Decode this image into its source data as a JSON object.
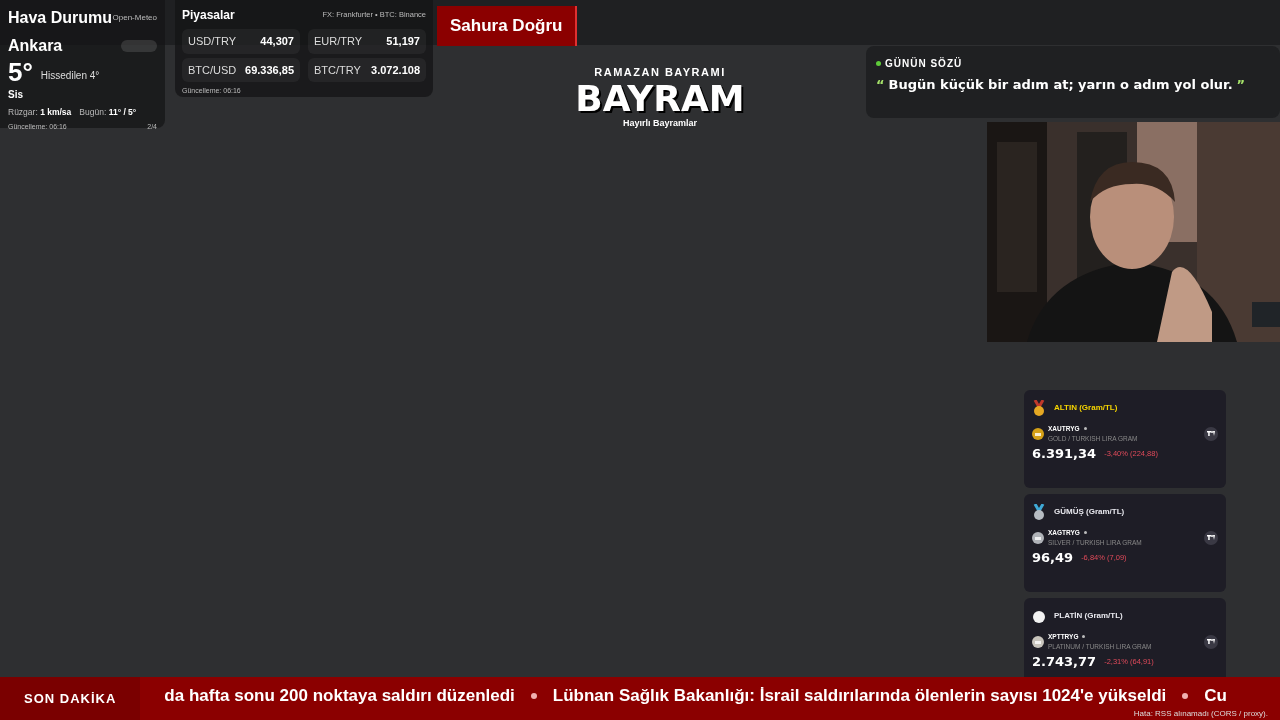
{
  "weather": {
    "title": "Hava Durumu",
    "source": "Open-Meteo",
    "city": "Ankara",
    "temperature": "5°",
    "feels_like": "Hissedilen 4°",
    "condition": "Sis",
    "wind_label": "Rüzgar:",
    "wind": "1 km/sa",
    "today_label": "Bugün:",
    "today": "11° / 5°",
    "updated": "Güncelleme: 06:16",
    "page": "2/4"
  },
  "markets": {
    "title": "Piyasalar",
    "source": "FX: Frankfurter • BTC: Binance",
    "updated": "Güncelleme: 06:16",
    "rates": [
      {
        "pair": "USD/TRY",
        "value": "44,307"
      },
      {
        "pair": "EUR/TRY",
        "value": "51,197"
      },
      {
        "pair": "BTC/USD",
        "value": "69.336,85"
      },
      {
        "pair": "BTC/TRY",
        "value": "3.072.108"
      }
    ]
  },
  "countdown": {
    "label": "Sahura Doğru"
  },
  "headline": {
    "overline": "RAMAZAN BAYRAMI",
    "title": "BAYRAM",
    "subtitle": "Hayırlı Bayramlar"
  },
  "quote": {
    "label": "GÜNÜN SÖZÜ",
    "open_mark": "“",
    "text": "Bugün küçük bir adım at; yarın o adım yol olur.",
    "close_mark": "”"
  },
  "metals": [
    {
      "title": "ALTIN (Gram/TL)",
      "kind": "gold",
      "color": "#d4a017",
      "symbol": "XAUTRYG",
      "description": "GOLD / TURKISH LIRA GRAM",
      "price": "6.391,34",
      "change": "-3,40% (224,88)"
    },
    {
      "title": "GÜMÜŞ (Gram/TL)",
      "kind": "silver",
      "color": "#b0b3b8",
      "symbol": "XAGTRYG",
      "description": "SILVER / TURKISH LIRA GRAM",
      "price": "96,49",
      "change": "-6,84% (7,09)"
    },
    {
      "title": "PLATİN (Gram/TL)",
      "kind": "plain",
      "color": "#c8c4bc",
      "symbol": "XPTTRYG",
      "description": "PLATINUM / TURKISH LIRA GRAM",
      "price": "2.743,77",
      "change": "-2,31% (64,91)"
    }
  ],
  "ticker": {
    "label": "SON DAKİKA",
    "items": [
      "da hafta sonu 200 noktaya saldırı düzenledi",
      "Lübnan Sağlık Bakanlığı: İsrail saldırılarında ölenlerin sayısı 1024'e yükseldi",
      "Cu"
    ]
  },
  "error_note": "Hata: RSS alınamadı (CORS / proxy)."
}
